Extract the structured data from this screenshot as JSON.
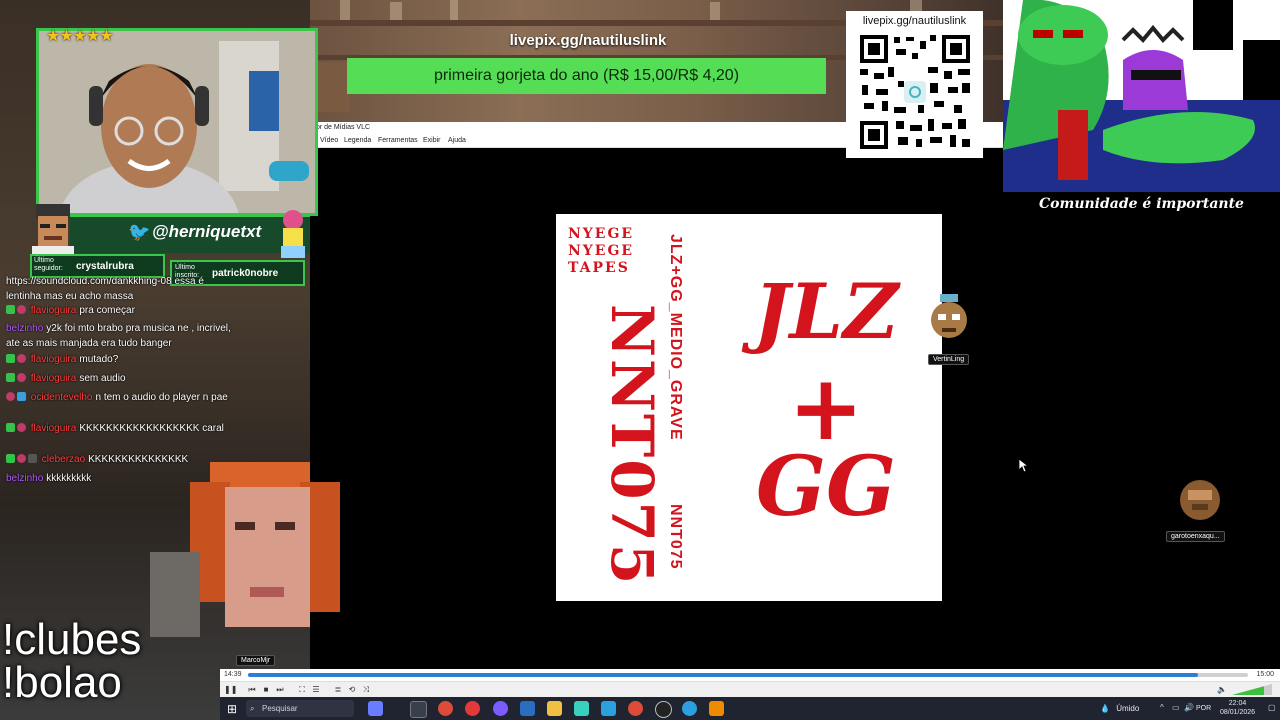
{
  "donation": {
    "url": "livepix.gg/nautiluslink",
    "message": "primeira gorjeta do ano (R$ 15,00/R$ 4,20)"
  },
  "qr": {
    "label": "livepix.gg/nautiluslink"
  },
  "cartoon": {
    "caption": "Comunidade é importante"
  },
  "social": {
    "twitter_handle": "@herniquetxt",
    "last_follower_label": "Último seguidor:",
    "last_follower_name": "crystalrubra",
    "last_subscriber_label": "Último inscrito:",
    "last_subscriber_name": "patrick0nobre"
  },
  "vlc": {
    "title": "tor de Mídias VLC",
    "menu": [
      "Vídeo",
      "Legenda",
      "Ferramentas",
      "Exibir",
      "Ajuda"
    ],
    "time_current": "14:39",
    "time_total": "15:00",
    "progress": 0.95
  },
  "album": {
    "nyege": "NYEGE\nNYEGE\nTAPES",
    "big_left": "NNT075",
    "vertical_title": "JLZ+GG_MEDIO_GRAVE",
    "vertical_code": "NNT075",
    "jlz": "JLZ",
    "plus": "+",
    "gg": "GG"
  },
  "chat": [
    {
      "user": "",
      "text": "https://soundcloud.com/dankkhing-08 essa é lentinha mas eu acho massa",
      "user_color": "#ff4040"
    },
    {
      "user": "flavioguira",
      "text": "pra começar",
      "user_color": "#ff4040"
    },
    {
      "user": "belzinho",
      "text": "y2k foi mto brabo pra musica ne , incrivel, ate as mais manjada era tudo banger",
      "user_color": "#b65cff"
    },
    {
      "user": "flavioguira",
      "text": "mutado?",
      "user_color": "#ff4040"
    },
    {
      "user": "flavioguira",
      "text": "sem audio",
      "user_color": "#ff4040"
    },
    {
      "user": "ocidentevelho",
      "text": "n tem o audio do player n pae",
      "user_color": "#ff4040"
    },
    {
      "user": "flavioguira",
      "text": "KKKKKKKKKKKKKKKKKK caral",
      "user_color": "#ff4040"
    },
    {
      "user": "cleberzao",
      "text": "KKKKKKKKKKKKKKK",
      "user_color": "#ff4040"
    },
    {
      "user": "belzinho",
      "text": "kkkkkkkkk",
      "user_color": "#b65cff"
    }
  ],
  "commands": [
    "!clubes",
    "!bolao"
  ],
  "avatars": {
    "a1": "VertinLing",
    "a2": "garotoenxaqu...",
    "a3": "MarcoMjr"
  },
  "taskbar": {
    "search_placeholder": "Pesquisar",
    "weather": "Úmido",
    "lang": "POR",
    "time": "22:04",
    "date": "08/01/2026"
  },
  "stars": "★★★★★"
}
